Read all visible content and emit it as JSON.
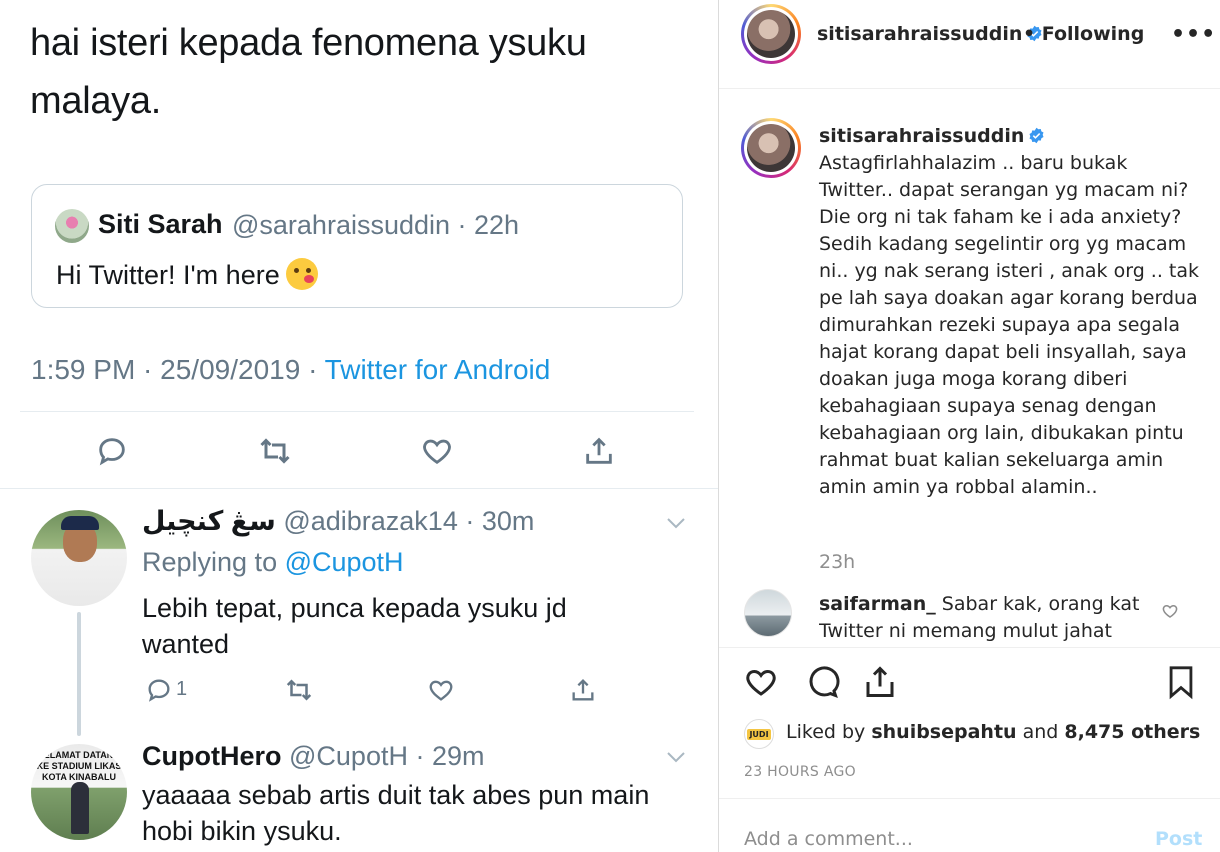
{
  "tweet": {
    "body_line1": "hai isteri kepada fenomena ysuku",
    "body_line2": "malaya.",
    "quoted": {
      "name": "Siti Sarah",
      "handle_time": "@sarahraissuddin · 22h",
      "text": "Hi Twitter! I'm here"
    },
    "meta_time": "1:59 PM · 25/09/2019 · ",
    "meta_source": "Twitter for Android"
  },
  "replies": [
    {
      "name": "سڠ كنچيل",
      "handle_time": "@adibrazak14 · 30m",
      "replying_prefix": "Replying to ",
      "replying_to": "@CupotH",
      "text_line1": "Lebih tepat, punca kepada ysuku jd",
      "text_line2": "wanted",
      "reply_count": "1"
    },
    {
      "name": "CupotHero",
      "handle_time": "@CupotH · 29m",
      "avatar_sign": "SELAMAT DATANG KE STADIUM LIKAS KOTA KINABALU",
      "text_line1": "yaaaaa sebab artis duit tak abes pun main",
      "text_line2": "hobi bikin ysuku."
    }
  ],
  "instagram": {
    "header": {
      "username": "sitisarahraissuddin",
      "follow_label": "• Following",
      "more": "•••"
    },
    "caption": {
      "username": "sitisarahraissuddin",
      "text": "Astagfirlahhalazim .. baru bukak Twitter.. dapat serangan yg macam ni? Die org ni tak faham ke i ada anxiety? Sedih kadang segelintir org yg macam ni.. yg nak serang isteri , anak org .. tak pe lah saya doakan agar korang berdua dimurahkan rezeki supaya apa segala hajat korang dapat beli insyallah, saya doakan juga moga korang diberi kebahagiaan supaya senag dengan kebahagiaan org lain, dibukakan pintu rahmat buat kalian sekeluarga amin amin amin ya robbal alamin..",
      "age": "23h"
    },
    "comment": {
      "username": "saifarman_",
      "text": "Sabar kak, orang kat Twitter ni memang mulut jahat"
    },
    "likes": {
      "avatar_label": "JUDI",
      "prefix": "Liked by ",
      "user": "shuibsepahtu",
      "middle": " and ",
      "others": "8,475 others"
    },
    "timestamp": "23 HOURS AGO",
    "add_comment_placeholder": "Add a comment...",
    "post_label": "Post"
  },
  "colors": {
    "twitter_blue": "#1b95e0",
    "twitter_gray": "#657786",
    "instagram_text": "#262626",
    "instagram_gray": "#8e8e8e",
    "post_disabled": "#b2dffc",
    "verified_blue": "#3897f0"
  },
  "icons": [
    "reply-icon",
    "retweet-icon",
    "like-icon",
    "share-icon",
    "chevron-down-icon",
    "verified-icon",
    "heart-icon",
    "comment-icon",
    "send-icon",
    "bookmark-icon"
  ]
}
